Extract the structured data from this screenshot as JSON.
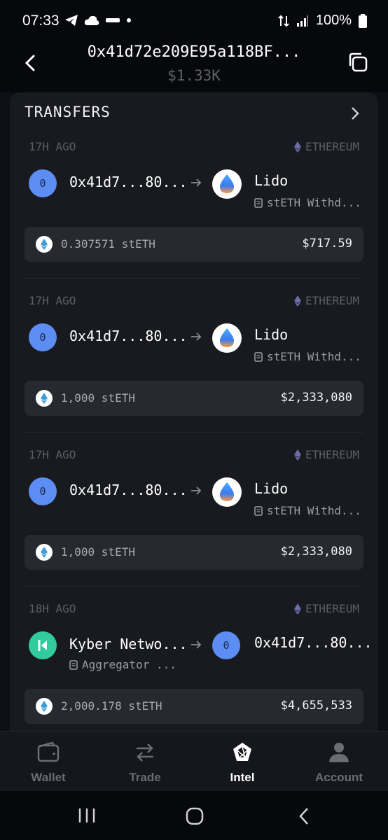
{
  "status_bar": {
    "time": "07:33",
    "battery": "100%"
  },
  "header": {
    "address": "0x41d72e209E95a118BF...",
    "balance": "$1.33K"
  },
  "section": {
    "title": "TRANSFERS"
  },
  "transfers": [
    {
      "time_ago": "17H AGO",
      "chain": "ETHEREUM",
      "from_avatar": "0",
      "from_label": "0x41d7...80...",
      "to_label": "Lido",
      "to_sub": "stETH Withd...",
      "amount": "0.307571 stETH",
      "usd": "$717.59"
    },
    {
      "time_ago": "17H AGO",
      "chain": "ETHEREUM",
      "from_avatar": "0",
      "from_label": "0x41d7...80...",
      "to_label": "Lido",
      "to_sub": "stETH Withd...",
      "amount": "1,000 stETH",
      "usd": "$2,333,080"
    },
    {
      "time_ago": "17H AGO",
      "chain": "ETHEREUM",
      "from_avatar": "0",
      "from_label": "0x41d7...80...",
      "to_label": "Lido",
      "to_sub": "stETH Withd...",
      "amount": "1,000 stETH",
      "usd": "$2,333,080"
    },
    {
      "time_ago": "18H AGO",
      "chain": "ETHEREUM",
      "from_label": "Kyber Netwo...",
      "from_sub": "Aggregator ...",
      "to_avatar": "0",
      "to_label": "0x41d7...80...",
      "amount": "2,000.178 stETH",
      "usd": "$4,655,533"
    }
  ],
  "nav": {
    "wallet": "Wallet",
    "trade": "Trade",
    "intel": "Intel",
    "account": "Account"
  },
  "icons": {
    "chain_icon": "ethereum-icon",
    "token_icon": "steth-icon",
    "lido_icon": "lido-icon",
    "kyber_icon": "kyber-icon"
  },
  "colors": {
    "background": "#0d0f14",
    "panel": "#181a20",
    "address_avatar": "#5b8df2",
    "kyber": "#31cb9e"
  }
}
